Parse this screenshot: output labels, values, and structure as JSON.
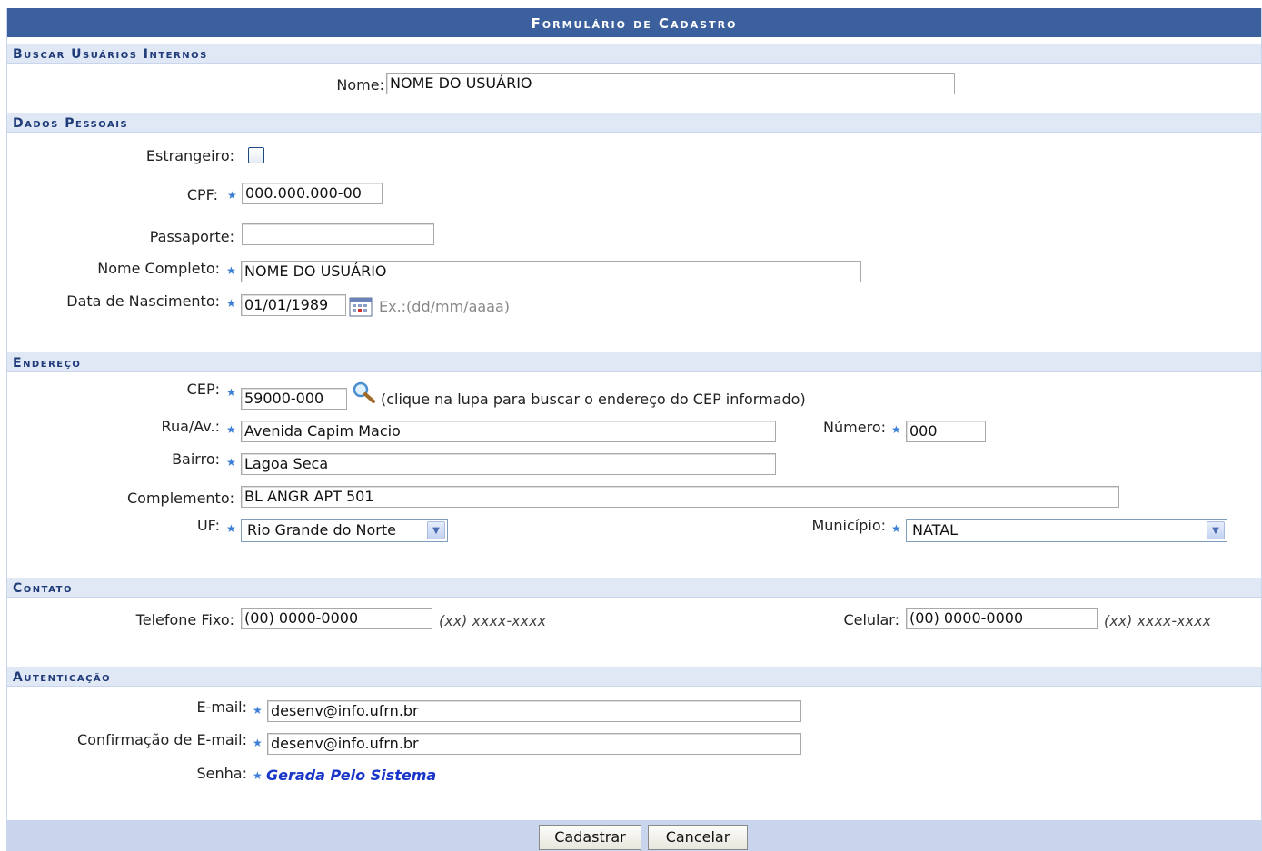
{
  "title": "Formulário de Cadastro",
  "sections": {
    "buscar": "Buscar Usuários Internos",
    "dados": "Dados Pessoais",
    "endereco": "Endereço",
    "contato": "Contato",
    "autenticacao": "Autenticação"
  },
  "buscar": {
    "nome_label": "Nome:",
    "nome_value": "NOME DO USUÁRIO"
  },
  "dados": {
    "estrangeiro_label": "Estrangeiro:",
    "estrangeiro_checked": false,
    "cpf_label": "CPF:",
    "cpf_value": "000.000.000-00",
    "passaporte_label": "Passaporte:",
    "passaporte_value": "",
    "nome_completo_label": "Nome Completo:",
    "nome_completo_value": "NOME DO USUÁRIO",
    "nascimento_label": "Data de Nascimento:",
    "nascimento_value": "01/01/1989",
    "nascimento_hint": "Ex.:(dd/mm/aaaa)"
  },
  "endereco": {
    "cep_label": "CEP:",
    "cep_value": "59000-000",
    "cep_hint": "(clique na lupa para buscar o endereço do CEP informado)",
    "rua_label": "Rua/Av.:",
    "rua_value": "Avenida Capim Macio",
    "numero_label": "Número:",
    "numero_value": "000",
    "bairro_label": "Bairro:",
    "bairro_value": "Lagoa Seca",
    "complemento_label": "Complemento:",
    "complemento_value": "BL ANGR APT 501",
    "uf_label": "UF:",
    "uf_value": "Rio Grande do Norte",
    "municipio_label": "Município:",
    "municipio_value": "NATAL"
  },
  "contato": {
    "fixo_label": "Telefone Fixo:",
    "fixo_value": "(00) 0000-0000",
    "fixo_hint": "(xx) xxxx-xxxx",
    "celular_label": "Celular:",
    "celular_value": "(00) 0000-0000",
    "celular_hint": "(xx) xxxx-xxxx"
  },
  "autenticacao": {
    "email_label": "E-mail:",
    "email_value": "desenv@info.ufrn.br",
    "confirma_label": "Confirmação de E-mail:",
    "confirma_value": "desenv@info.ufrn.br",
    "senha_label": "Senha:",
    "senha_value": "Gerada Pelo Sistema"
  },
  "buttons": {
    "cadastrar": "Cadastrar",
    "cancelar": "Cancelar"
  },
  "icons": {
    "required": "star-icon",
    "calendar": "calendar-icon",
    "search": "magnifier-icon"
  },
  "colors": {
    "title_bar": "#3c5f9e",
    "section_bg": "#e0e8f6",
    "section_text": "#1f3b78",
    "required_star": "#3a7fd5",
    "senha_text": "#1a36c8"
  }
}
